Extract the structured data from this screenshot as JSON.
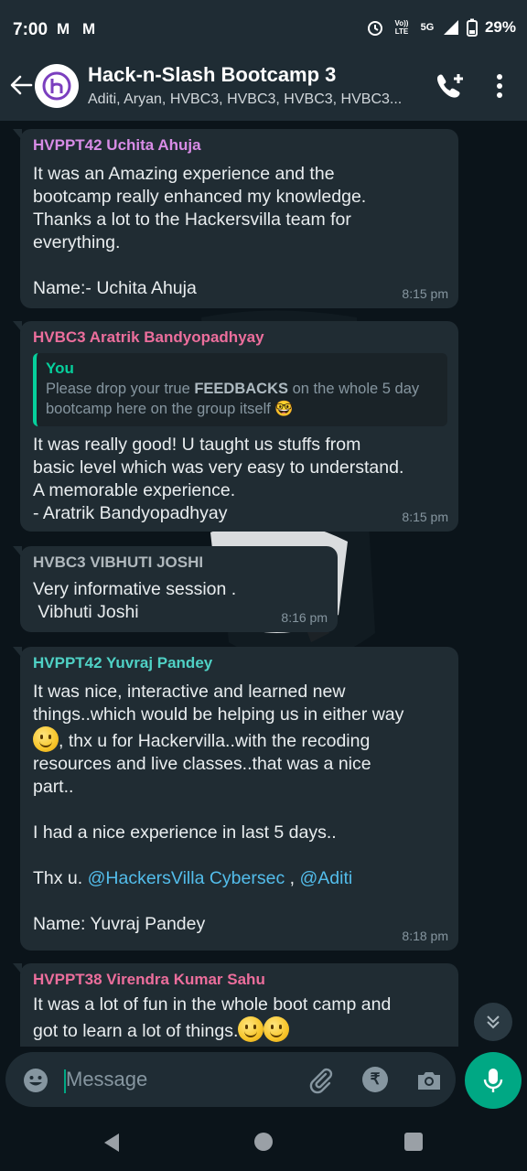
{
  "status_bar": {
    "time": "7:00",
    "mail_icons": [
      "M",
      "M"
    ],
    "volte_top": "Vo)) LTE",
    "network": "5G",
    "battery": "29%"
  },
  "header": {
    "title": "Hack-n-Slash Bootcamp 3",
    "members": "Aditi, Aryan, HVBC3, HVBC3, HVBC3, HVBC3..."
  },
  "messages": [
    {
      "sender": "HVPPT42 Uchita Ahuja",
      "sender_color": "#d88ce6",
      "text": "It was an Amazing experience and the\nbootcamp really enhanced my knowledge.\nThanks a lot to the Hackersvilla team for\neverything.\n\nName:- Uchita Ahuja",
      "time": "8:15 pm"
    },
    {
      "sender": "HVBC3 Aratrik Bandyopadhyay",
      "sender_color": "#ec6e9c",
      "quote": {
        "name": "You",
        "text_before": "Please drop your true ",
        "text_bold": "FEEDBACKS",
        "text_after": " on the whole 5 day bootcamp here on the group itself 🤓"
      },
      "text": "It was really good! U taught us stuffs from\nbasic level which was very easy to understand.\nA memorable experience.\n- Aratrik Bandyopadhyay",
      "time": "8:15 pm"
    },
    {
      "sender": "HVBC3 VIBHUTI JOSHI",
      "sender_color": "#b0b8bd",
      "text": "Very informative session .\n Vibhuti Joshi",
      "time": "8:16 pm"
    },
    {
      "sender": "HVPPT42 Yuvraj Pandey",
      "sender_color": "#4fd1c5",
      "text_p1": "It was nice, interactive and learned new\nthings..which would be helping us in either way",
      "text_p2": ", thx u for Hackervilla..with the recoding\nresources and live classes..that was a nice\npart..",
      "text_p3": "I had a nice experience in last 5 days..",
      "thx_prefix": "Thx u. ",
      "mention1": "@HackersVilla Cybersec",
      "mention_sep": " , ",
      "mention2": "@Aditi",
      "text_name": "Name: Yuvraj Pandey",
      "time": "8:18 pm"
    },
    {
      "sender": "HVPPT38 Virendra Kumar Sahu",
      "sender_color": "#ec6e9c",
      "text_p1": "It was a lot of fun in the whole boot camp and\ngot to learn a lot of things."
    }
  ],
  "input": {
    "placeholder": "Message"
  },
  "colors": {
    "accent": "#00a884",
    "bubble": "#202c33",
    "background": "#0b141a"
  },
  "icons": [
    "back-arrow-icon",
    "add-call-icon",
    "more-options-icon",
    "emoji-icon",
    "attach-icon",
    "rupee-icon",
    "camera-icon",
    "mic-icon",
    "scroll-down-icon"
  ]
}
